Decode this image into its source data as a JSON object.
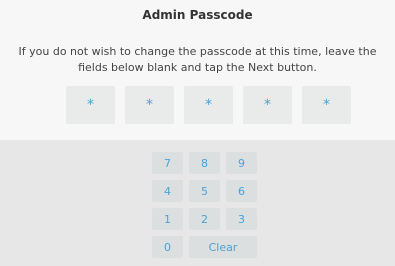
{
  "header": {
    "title": "Admin Passcode"
  },
  "message": "If you do not wish to change the passcode at this time, leave the fields below blank and tap the Next button.",
  "passcode_fields": [
    "*",
    "*",
    "*",
    "*",
    "*"
  ],
  "keypad": {
    "keys": [
      "7",
      "8",
      "9",
      "4",
      "5",
      "6",
      "1",
      "2",
      "3",
      "0"
    ],
    "clear_label": "Clear"
  },
  "colors": {
    "accent": "#4aa3d8",
    "field_bg": "#e9eaea",
    "pad_bg": "#e6e7e6"
  }
}
